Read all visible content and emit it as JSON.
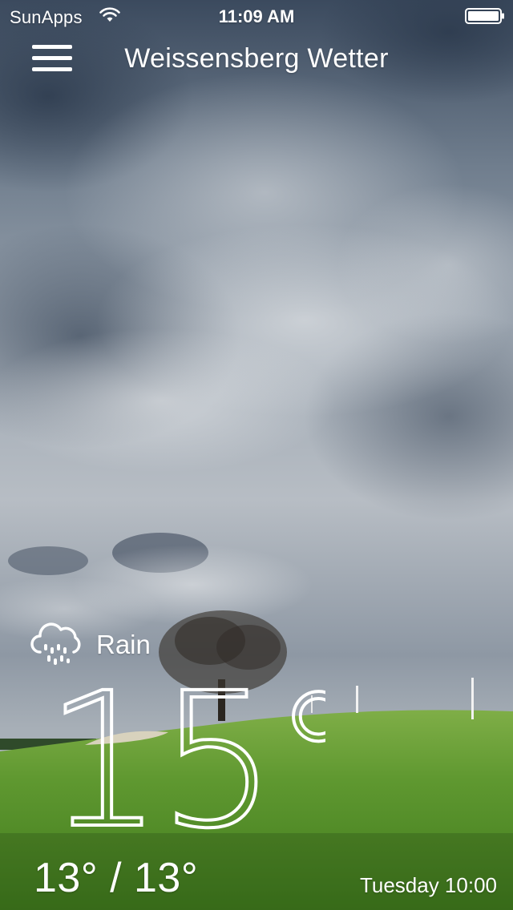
{
  "status_bar": {
    "carrier": "SunApps",
    "time": "11:09 AM"
  },
  "nav": {
    "title": "Weissensberg Wetter"
  },
  "weather": {
    "condition": "Rain",
    "condition_icon": "rain-cloud-icon",
    "temperature": "15°",
    "high_low": "13° / 13°",
    "updated": "Tuesday 10:00"
  },
  "colors": {
    "text": "#ffffff",
    "sky_dark": "#3e4d61",
    "sky_light": "#c9ced4",
    "grass": "#5f9a2e"
  }
}
